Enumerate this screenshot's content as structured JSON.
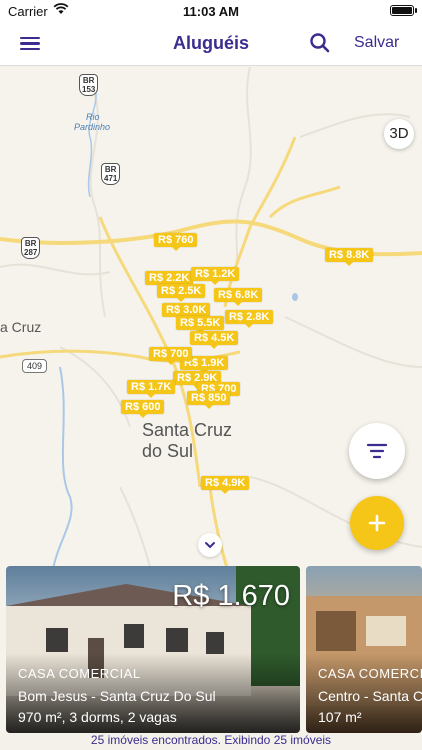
{
  "status_bar": {
    "carrier": "Carrier",
    "time": "11:03 AM"
  },
  "navbar": {
    "title": "Aluguéis",
    "save_label": "Salvar",
    "menu_icon": "hamburger-icon",
    "search_icon": "search-icon"
  },
  "map": {
    "labels": {
      "city": "Santa Cruz do Sul",
      "city_line1": "Santa Cruz",
      "city_line2": "do Sul",
      "west_partial": "a Cruz",
      "river": "Rio Pardinho",
      "river_line1": "Rio",
      "river_line2": "Pardinho"
    },
    "shields": [
      {
        "line1": "BR",
        "line2": "153"
      },
      {
        "line1": "BR",
        "line2": "471"
      },
      {
        "line1": "BR",
        "line2": "287"
      }
    ],
    "road_numbers": [
      "409"
    ],
    "button_3d": "3D",
    "price_pins": [
      "R$ 760",
      "R$ 2.2K",
      "R$ 1.2K",
      "R$ 2.5K",
      "R$ 6.8K",
      "R$ 3.0K",
      "R$ 2.8K",
      "R$ 5.5K",
      "R$ 4.5K",
      "R$ 1.9K",
      "R$ 700",
      "R$ 2.9K",
      "R$ 1.7K",
      "R$ 700",
      "R$ 850",
      "R$ 600",
      "R$ 8.8K",
      "R$ 4.9K"
    ]
  },
  "listings": [
    {
      "price": "R$ 1.670",
      "type": "CASA COMERCIAL",
      "location": "Bom Jesus - Santa Cruz Do Sul",
      "specs": "970 m², 3 dorms, 2 vagas"
    },
    {
      "price": "",
      "type": "CASA COMERCIAL",
      "location": "Centro - Santa Cruz Do Sul",
      "specs": "107 m²"
    }
  ],
  "footer": {
    "summary": "25 imóveis encontrados. Exibindo 25 imóveis"
  },
  "colors": {
    "brand": "#3a2d8f",
    "accent": "#f5c518",
    "road": "#f6d97a"
  }
}
